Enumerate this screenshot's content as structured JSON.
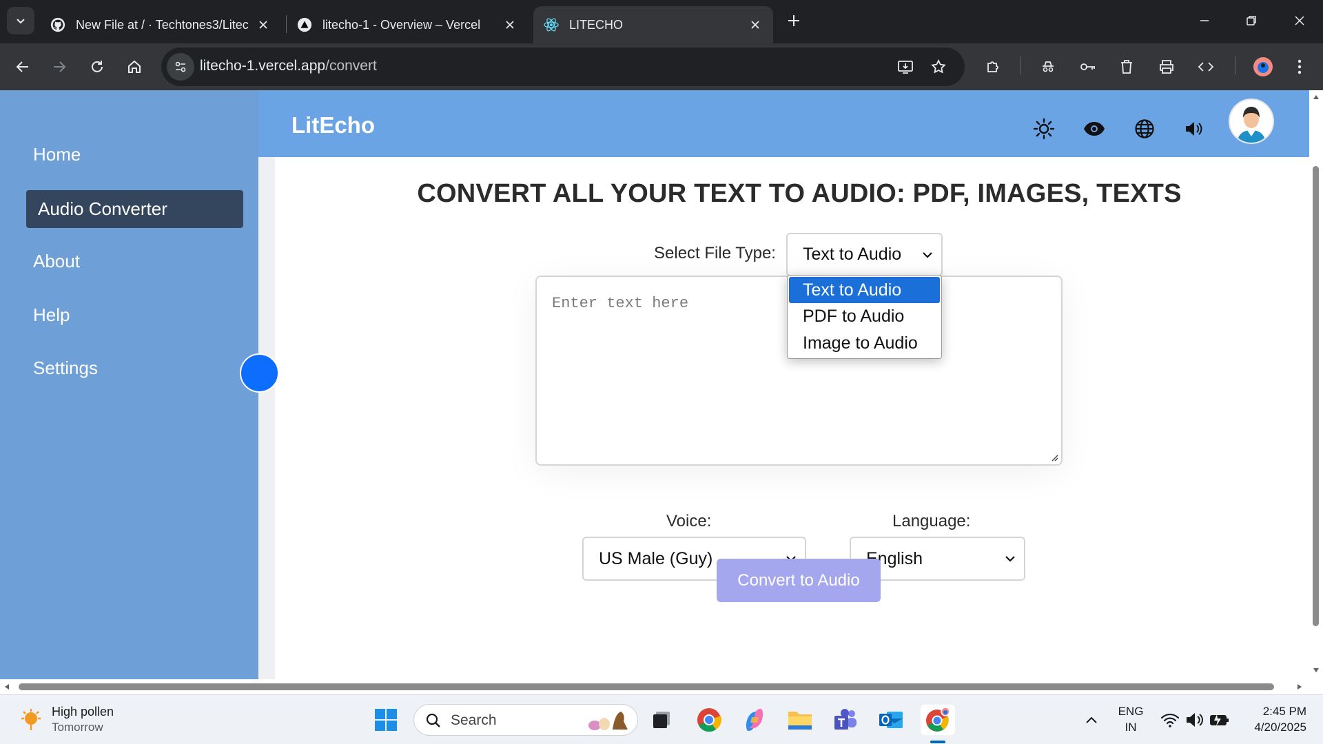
{
  "browser": {
    "tabs": [
      {
        "title": "New File at / · Techtones3/Litech",
        "favicon": "github-icon"
      },
      {
        "title": "litecho-1 - Overview – Vercel",
        "favicon": "vercel-icon"
      },
      {
        "title": "LITECHO",
        "favicon": "react-icon",
        "active": true
      }
    ],
    "url_host": "litecho-1.vercel.app",
    "url_path": "/convert"
  },
  "sidebar": {
    "items": [
      {
        "label": "Home"
      },
      {
        "label": "Audio Converter",
        "active": true
      },
      {
        "label": "About"
      },
      {
        "label": "Help"
      },
      {
        "label": "Settings"
      }
    ]
  },
  "header": {
    "brand": "LitEcho",
    "icons": [
      "sun-icon",
      "eye-icon",
      "globe-icon",
      "speaker-icon"
    ]
  },
  "main": {
    "title": "CONVERT ALL YOUR TEXT TO AUDIO: PDF, IMAGES, TEXTS",
    "file_type_label": "Select File Type:",
    "file_type_value": "Text to Audio",
    "file_type_options": [
      "Text to Audio",
      "PDF to Audio",
      "Image to Audio"
    ],
    "text_placeholder": "Enter text here",
    "voice_label": "Voice:",
    "voice_value": "US Male (Guy)",
    "language_label": "Language:",
    "language_value": "English",
    "convert_label": "Convert to Audio"
  },
  "taskbar": {
    "weather_line1": "High pollen",
    "weather_line2": "Tomorrow",
    "search_label": "Search",
    "lang_line1": "ENG",
    "lang_line2": "IN",
    "time": "2:45 PM",
    "date": "4/20/2025"
  },
  "colors": {
    "sidebar": "#6e9fd6",
    "sidebar_active": "#33465e",
    "header": "#6aa4e4",
    "convert_button": "#a4a6ee",
    "dropdown_highlight": "#1a6fd9"
  }
}
